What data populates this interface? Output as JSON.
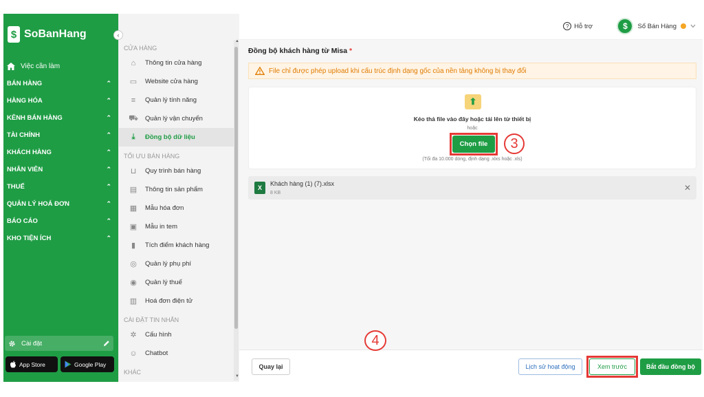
{
  "app": {
    "logo_text": "SoBanHang",
    "logo_mark": "$",
    "collapse_glyph": "‹"
  },
  "sidebar": {
    "home_label": "Việc cần làm",
    "items": [
      {
        "label": "BÁN HÀNG"
      },
      {
        "label": "HÀNG HÓA"
      },
      {
        "label": "KÊNH BÁN HÀNG"
      },
      {
        "label": "TÀI CHÍNH"
      },
      {
        "label": "KHÁCH HÀNG"
      },
      {
        "label": "NHÂN VIÊN"
      },
      {
        "label": "THUẾ"
      },
      {
        "label": "QUẢN LÝ HOÁ ĐƠN"
      },
      {
        "label": "BÁO CÁO"
      },
      {
        "label": "KHO TIỆN ÍCH"
      }
    ],
    "settings_label": "Cài đặt",
    "app_store_label": "App Store",
    "google_play_label": "Google Play"
  },
  "submenu": {
    "section_store": "CỬA HÀNG",
    "store_items": [
      {
        "label": "Thông tin cửa hàng",
        "icon": "store-icon"
      },
      {
        "label": "Website cửa hàng",
        "icon": "website-icon"
      },
      {
        "label": "Quản lý tính năng",
        "icon": "menu-icon"
      },
      {
        "label": "Quản lý vận chuyển",
        "icon": "truck-icon"
      },
      {
        "label": "Đồng bộ dữ liệu",
        "icon": "sync-download-icon",
        "active": true
      }
    ],
    "section_optimize": "TỐI ƯU BÁN HÀNG",
    "optimize_items": [
      {
        "label": "Quy trình bán hàng",
        "icon": "basket-icon"
      },
      {
        "label": "Thông tin sản phẩm",
        "icon": "box-icon"
      },
      {
        "label": "Mẫu hóa đơn",
        "icon": "invoice-icon"
      },
      {
        "label": "Mẫu in tem",
        "icon": "label-icon"
      },
      {
        "label": "Tích điểm khách hàng",
        "icon": "bookmark-icon"
      },
      {
        "label": "Quản lý phụ phí",
        "icon": "coins-icon"
      },
      {
        "label": "Quản lý thuế",
        "icon": "tax-icon"
      },
      {
        "label": "Hoá đơn điện tử",
        "icon": "e-invoice-icon"
      }
    ],
    "section_message": "CÀI ĐẶT TIN NHẮN",
    "message_items": [
      {
        "label": "Cấu hình",
        "icon": "gear-icon"
      },
      {
        "label": "Chatbot",
        "icon": "chatbot-icon"
      }
    ],
    "section_other": "KHÁC"
  },
  "header": {
    "help_label": "Hỗ trợ",
    "user_name": "Sổ Bán Hàng",
    "avatar_text": "$"
  },
  "main": {
    "title": "Đồng bộ khách hàng từ Misa",
    "required_mark": "*",
    "warning": "File chỉ được phép upload khi cấu trúc định dạng gốc của nền tảng không bị thay đổi",
    "drop_text": "Kéo thả file vào đây hoặc tải lên từ thiết bị",
    "or_text": "hoặc",
    "choose_button": "Chọn file",
    "hint": "(Tối đa 10.000 dòng, định dạng .xlxs hoặc .xls)",
    "step3": "3",
    "file": {
      "name": "Khách hàng (1) (7).xlsx",
      "size": "8 KB"
    }
  },
  "footer": {
    "back_button": "Quay lại",
    "history_button": "Lịch sử hoạt động",
    "preview_button": "Xem trước",
    "sync_button": "Bắt đầu đồng bộ",
    "step4": "4"
  },
  "colors": {
    "brand_green": "#1f9d45",
    "annotation_red": "#e53935",
    "warning_orange": "#e07b00"
  }
}
